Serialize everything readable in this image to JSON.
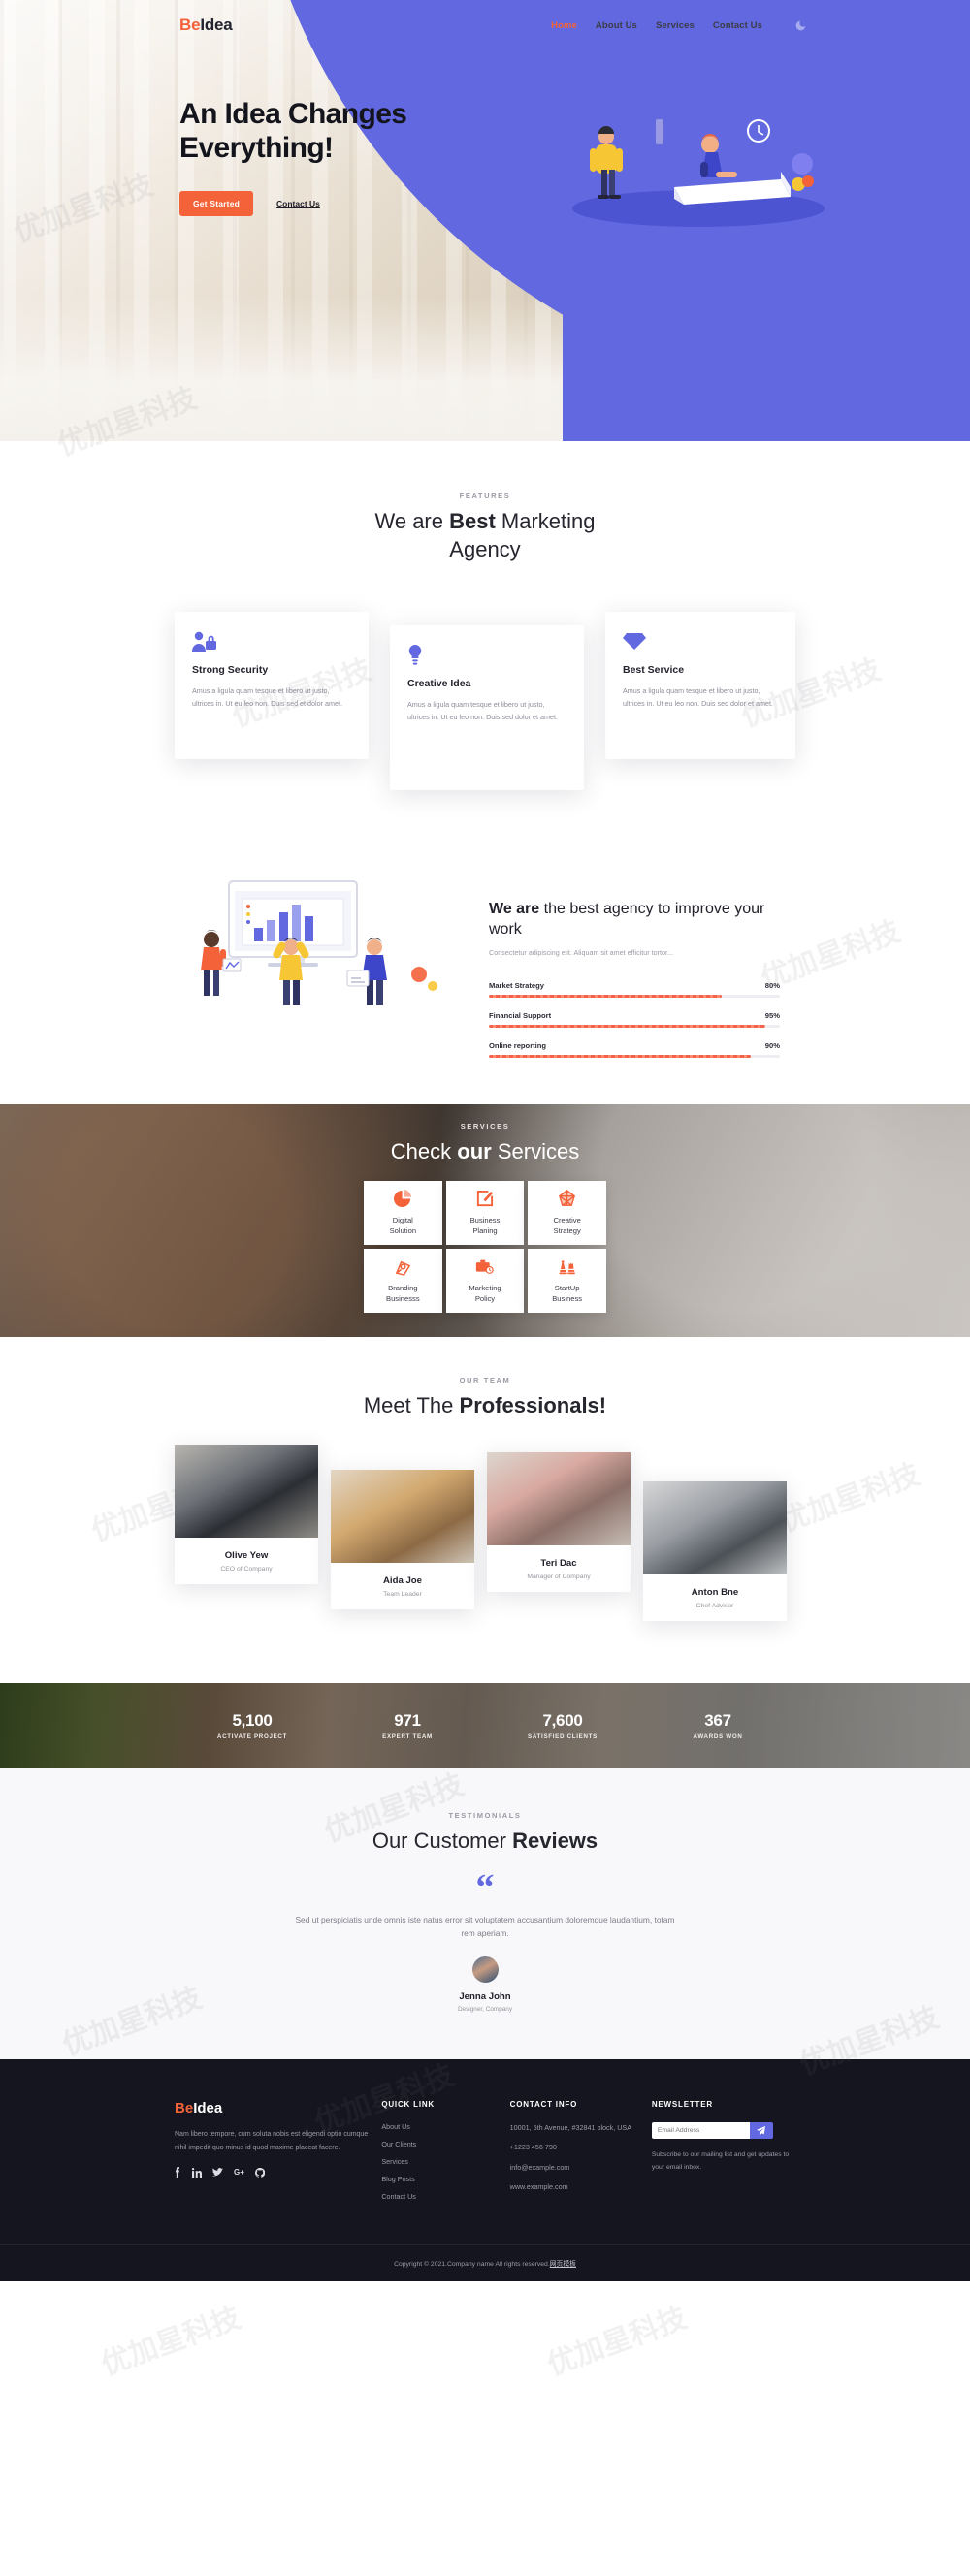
{
  "brand": {
    "prefix": "Be",
    "suffix": "Idea",
    "accent": "#f4623a",
    "purple": "#6168e0"
  },
  "nav": {
    "items": [
      {
        "label": "Home",
        "active": true
      },
      {
        "label": "About Us",
        "active": false
      },
      {
        "label": "Services",
        "active": false
      },
      {
        "label": "Contact Us",
        "active": false
      }
    ],
    "theme_toggle_icon": "moon-icon"
  },
  "hero": {
    "title": "An Idea Changes Everything!",
    "primary_button": "Get Started",
    "secondary_link": "Contact Us"
  },
  "features": {
    "label": "FEATURES",
    "title_plain_1": "We are ",
    "title_bold": "Best",
    "title_plain_2": " Marketing Agency",
    "cards": [
      {
        "icon": "user-lock-icon",
        "title": "Strong Security",
        "text": "Amus a ligula quam tesque et libero ut justo, ultrices in. Ut eu leo non. Duis sed et dolor amet."
      },
      {
        "icon": "lightbulb-icon",
        "title": "Creative Idea",
        "text": "Amus a ligula quam tesque et libero ut justo, ultrices in. Ut eu leo non. Duis sed dolor et amet."
      },
      {
        "icon": "diamond-icon",
        "title": "Best Service",
        "text": "Amus a ligula quam tesque et libero ut justo, ultrices in. Ut eu leo non. Duis sed dolor et amet."
      }
    ]
  },
  "about": {
    "title_bold": "We are",
    "title_plain": " the best agency to improve your work",
    "subtitle": "Consectetur adipiscing elit. Aliquam sit amet efficitur tortor...",
    "skills": [
      {
        "name": "Market Strategy",
        "percent": 80,
        "percent_label": "80%"
      },
      {
        "name": "Financial Support",
        "percent": 95,
        "percent_label": "95%"
      },
      {
        "name": "Online reporting",
        "percent": 90,
        "percent_label": "90%"
      }
    ],
    "illustration": "team-presentation-chart-illustration"
  },
  "services": {
    "label": "SERVICES",
    "title_plain_1": "Check ",
    "title_bold": "our",
    "title_plain_2": " Services",
    "cards": [
      {
        "icon": "pie-chart-icon",
        "line1": "Digital",
        "line2": "Solution"
      },
      {
        "icon": "edit-square-icon",
        "line1": "Business",
        "line2": "Planing"
      },
      {
        "icon": "polygon-web-icon",
        "line1": "Creative",
        "line2": "Strategy"
      },
      {
        "icon": "pen-nib-icon",
        "line1": "Branding",
        "line2": "Businesss"
      },
      {
        "icon": "briefcase-clock-icon",
        "line1": "Marketing",
        "line2": "Policy"
      },
      {
        "icon": "chess-pieces-icon",
        "line1": "StartUp",
        "line2": "Business"
      }
    ]
  },
  "team": {
    "label": "OUR TEAM",
    "title_plain": "Meet The ",
    "title_bold": "Professionals!",
    "members": [
      {
        "name": "Olive Yew",
        "role": "CEO of Company"
      },
      {
        "name": "Aida Joe",
        "role": "Team Leader"
      },
      {
        "name": "Teri Dac",
        "role": "Manager of Company"
      },
      {
        "name": "Anton Bne",
        "role": "Chef Advisor"
      }
    ]
  },
  "stats": [
    {
      "value": "5,100",
      "label": "ACTIVATE PROJECT"
    },
    {
      "value": "971",
      "label": "EXPERT TEAM"
    },
    {
      "value": "7,600",
      "label": "SATISFIED CLIENTS"
    },
    {
      "value": "367",
      "label": "AWARDS WON"
    }
  ],
  "testimonials": {
    "label": "TESTIMONIALS",
    "title_plain": "Our Customer ",
    "title_bold": "Reviews",
    "quote_icon": "quote-icon",
    "quote": "Sed ut perspiciatis unde omnis iste natus error sit voluptatem accusantium doloremque laudantium, totam rem aperiam.",
    "author": "Jenna John",
    "author_role": "Designer, Company"
  },
  "footer": {
    "about": "Nam libero tempore, cum soluta nobis est eligendi optio cumque nihil impedit quo minus id quod maxime placeat facere.",
    "social": [
      {
        "icon": "facebook-icon",
        "glyph": "f"
      },
      {
        "icon": "linkedin-icon",
        "glyph": "in"
      },
      {
        "icon": "twitter-icon",
        "glyph": "t"
      },
      {
        "icon": "google-plus-icon",
        "glyph": "G+"
      },
      {
        "icon": "github-icon",
        "glyph": "O"
      }
    ],
    "quick_link": {
      "heading": "QUICK LINK",
      "items": [
        "About Us",
        "Our Clients",
        "Services",
        "Blog Posts",
        "Contact Us"
      ]
    },
    "contact_info": {
      "heading": "CONTACT INFO",
      "lines": [
        "10001, 5th Avenue, #32841 block, USA",
        "+1223 456 790",
        "info@example.com",
        "www.example.com"
      ]
    },
    "newsletter": {
      "heading": "NEWSLETTER",
      "placeholder": "Email Address",
      "value": "",
      "send_icon": "paper-plane-icon",
      "note": "Subscribe to our mailing list and get updates to your email inbox."
    },
    "copyright": "Copyright © 2021.Company name All rights reserved.",
    "copyright_link": "网页模板"
  },
  "watermark": "优加星科技"
}
